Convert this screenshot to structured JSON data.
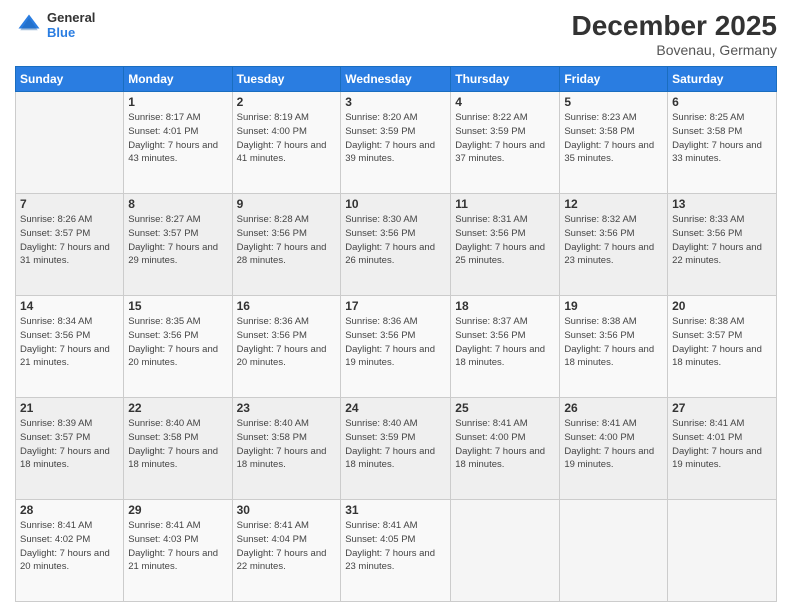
{
  "header": {
    "logo_line1": "General",
    "logo_line2": "Blue",
    "month_year": "December 2025",
    "location": "Bovenau, Germany"
  },
  "days_of_week": [
    "Sunday",
    "Monday",
    "Tuesday",
    "Wednesday",
    "Thursday",
    "Friday",
    "Saturday"
  ],
  "weeks": [
    [
      {
        "day": "",
        "sunrise": "",
        "sunset": "",
        "daylight": ""
      },
      {
        "day": "1",
        "sunrise": "Sunrise: 8:17 AM",
        "sunset": "Sunset: 4:01 PM",
        "daylight": "Daylight: 7 hours and 43 minutes."
      },
      {
        "day": "2",
        "sunrise": "Sunrise: 8:19 AM",
        "sunset": "Sunset: 4:00 PM",
        "daylight": "Daylight: 7 hours and 41 minutes."
      },
      {
        "day": "3",
        "sunrise": "Sunrise: 8:20 AM",
        "sunset": "Sunset: 3:59 PM",
        "daylight": "Daylight: 7 hours and 39 minutes."
      },
      {
        "day": "4",
        "sunrise": "Sunrise: 8:22 AM",
        "sunset": "Sunset: 3:59 PM",
        "daylight": "Daylight: 7 hours and 37 minutes."
      },
      {
        "day": "5",
        "sunrise": "Sunrise: 8:23 AM",
        "sunset": "Sunset: 3:58 PM",
        "daylight": "Daylight: 7 hours and 35 minutes."
      },
      {
        "day": "6",
        "sunrise": "Sunrise: 8:25 AM",
        "sunset": "Sunset: 3:58 PM",
        "daylight": "Daylight: 7 hours and 33 minutes."
      }
    ],
    [
      {
        "day": "7",
        "sunrise": "Sunrise: 8:26 AM",
        "sunset": "Sunset: 3:57 PM",
        "daylight": "Daylight: 7 hours and 31 minutes."
      },
      {
        "day": "8",
        "sunrise": "Sunrise: 8:27 AM",
        "sunset": "Sunset: 3:57 PM",
        "daylight": "Daylight: 7 hours and 29 minutes."
      },
      {
        "day": "9",
        "sunrise": "Sunrise: 8:28 AM",
        "sunset": "Sunset: 3:56 PM",
        "daylight": "Daylight: 7 hours and 28 minutes."
      },
      {
        "day": "10",
        "sunrise": "Sunrise: 8:30 AM",
        "sunset": "Sunset: 3:56 PM",
        "daylight": "Daylight: 7 hours and 26 minutes."
      },
      {
        "day": "11",
        "sunrise": "Sunrise: 8:31 AM",
        "sunset": "Sunset: 3:56 PM",
        "daylight": "Daylight: 7 hours and 25 minutes."
      },
      {
        "day": "12",
        "sunrise": "Sunrise: 8:32 AM",
        "sunset": "Sunset: 3:56 PM",
        "daylight": "Daylight: 7 hours and 23 minutes."
      },
      {
        "day": "13",
        "sunrise": "Sunrise: 8:33 AM",
        "sunset": "Sunset: 3:56 PM",
        "daylight": "Daylight: 7 hours and 22 minutes."
      }
    ],
    [
      {
        "day": "14",
        "sunrise": "Sunrise: 8:34 AM",
        "sunset": "Sunset: 3:56 PM",
        "daylight": "Daylight: 7 hours and 21 minutes."
      },
      {
        "day": "15",
        "sunrise": "Sunrise: 8:35 AM",
        "sunset": "Sunset: 3:56 PM",
        "daylight": "Daylight: 7 hours and 20 minutes."
      },
      {
        "day": "16",
        "sunrise": "Sunrise: 8:36 AM",
        "sunset": "Sunset: 3:56 PM",
        "daylight": "Daylight: 7 hours and 20 minutes."
      },
      {
        "day": "17",
        "sunrise": "Sunrise: 8:36 AM",
        "sunset": "Sunset: 3:56 PM",
        "daylight": "Daylight: 7 hours and 19 minutes."
      },
      {
        "day": "18",
        "sunrise": "Sunrise: 8:37 AM",
        "sunset": "Sunset: 3:56 PM",
        "daylight": "Daylight: 7 hours and 18 minutes."
      },
      {
        "day": "19",
        "sunrise": "Sunrise: 8:38 AM",
        "sunset": "Sunset: 3:56 PM",
        "daylight": "Daylight: 7 hours and 18 minutes."
      },
      {
        "day": "20",
        "sunrise": "Sunrise: 8:38 AM",
        "sunset": "Sunset: 3:57 PM",
        "daylight": "Daylight: 7 hours and 18 minutes."
      }
    ],
    [
      {
        "day": "21",
        "sunrise": "Sunrise: 8:39 AM",
        "sunset": "Sunset: 3:57 PM",
        "daylight": "Daylight: 7 hours and 18 minutes."
      },
      {
        "day": "22",
        "sunrise": "Sunrise: 8:40 AM",
        "sunset": "Sunset: 3:58 PM",
        "daylight": "Daylight: 7 hours and 18 minutes."
      },
      {
        "day": "23",
        "sunrise": "Sunrise: 8:40 AM",
        "sunset": "Sunset: 3:58 PM",
        "daylight": "Daylight: 7 hours and 18 minutes."
      },
      {
        "day": "24",
        "sunrise": "Sunrise: 8:40 AM",
        "sunset": "Sunset: 3:59 PM",
        "daylight": "Daylight: 7 hours and 18 minutes."
      },
      {
        "day": "25",
        "sunrise": "Sunrise: 8:41 AM",
        "sunset": "Sunset: 4:00 PM",
        "daylight": "Daylight: 7 hours and 18 minutes."
      },
      {
        "day": "26",
        "sunrise": "Sunrise: 8:41 AM",
        "sunset": "Sunset: 4:00 PM",
        "daylight": "Daylight: 7 hours and 19 minutes."
      },
      {
        "day": "27",
        "sunrise": "Sunrise: 8:41 AM",
        "sunset": "Sunset: 4:01 PM",
        "daylight": "Daylight: 7 hours and 19 minutes."
      }
    ],
    [
      {
        "day": "28",
        "sunrise": "Sunrise: 8:41 AM",
        "sunset": "Sunset: 4:02 PM",
        "daylight": "Daylight: 7 hours and 20 minutes."
      },
      {
        "day": "29",
        "sunrise": "Sunrise: 8:41 AM",
        "sunset": "Sunset: 4:03 PM",
        "daylight": "Daylight: 7 hours and 21 minutes."
      },
      {
        "day": "30",
        "sunrise": "Sunrise: 8:41 AM",
        "sunset": "Sunset: 4:04 PM",
        "daylight": "Daylight: 7 hours and 22 minutes."
      },
      {
        "day": "31",
        "sunrise": "Sunrise: 8:41 AM",
        "sunset": "Sunset: 4:05 PM",
        "daylight": "Daylight: 7 hours and 23 minutes."
      },
      {
        "day": "",
        "sunrise": "",
        "sunset": "",
        "daylight": ""
      },
      {
        "day": "",
        "sunrise": "",
        "sunset": "",
        "daylight": ""
      },
      {
        "day": "",
        "sunrise": "",
        "sunset": "",
        "daylight": ""
      }
    ]
  ]
}
